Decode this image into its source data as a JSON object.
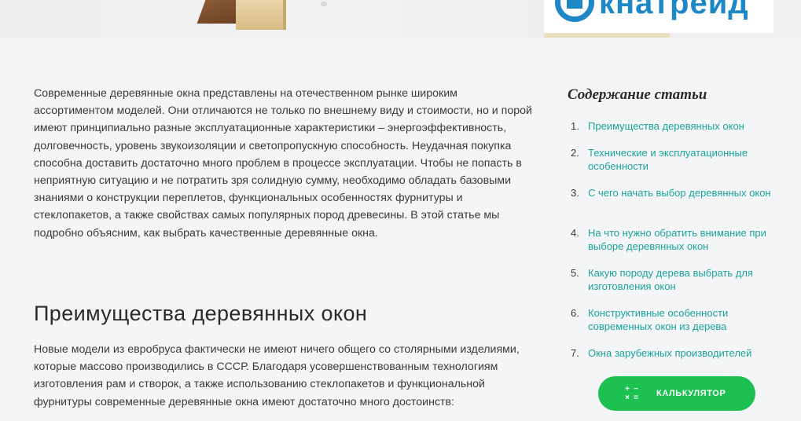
{
  "hero": {
    "logo_text": "кнатрейд",
    "logo_icon": "window-logo-icon"
  },
  "article": {
    "intro": "Современные деревянные окна представлены на отечественном рынке широким ассортиментом моделей. Они отличаются не только по внешнему виду и стоимости, но и порой имеют принципиально разные эксплуатационные характеристики – энергоэффективность, долговечность, уровень звукоизоляции и светопропускную способность. Неудачная покупка способна доставить достаточно много проблем в процессе эксплуатации. Чтобы не попасть в неприятную ситуацию и не потратить зря солидную сумму, необходимо обладать базовыми знаниями о конструкции переплетов, функциональных особенностях фурнитуры и стеклопакетов, а также свойствах самых популярных пород древесины. В этой статье мы подробно объясним, как выбрать качественные деревянные окна.",
    "section_title": "Преимущества деревянных окон",
    "section_text": "Новые модели из евробруса фактически не имеют ничего общего со столярными изделиями, которые массово производились в СССР. Благодаря усовершенствованным технологиям изготовления рам и створок, а также использованию стеклопакетов и функциональной фурнитуры современные деревянные окна имеют достаточно много достоинств:"
  },
  "toc": {
    "title": "Содержание статьи",
    "items": [
      {
        "num": "1.",
        "label": "Преимущества деревянных окон"
      },
      {
        "num": "2.",
        "label": "Технические и эксплуатационные особенности"
      },
      {
        "num": "3.",
        "label": "С чего начать выбор деревянных окон"
      },
      {
        "num": "4.",
        "label": "На что нужно обратить внимание при выборе деревянных окон"
      },
      {
        "num": "5.",
        "label": "Какую породу дерева выбрать для изготовления окон"
      },
      {
        "num": "6.",
        "label": "Конструктивные особенности современных окон из дерева"
      },
      {
        "num": "7.",
        "label": "Окна зарубежных производителей"
      }
    ]
  },
  "calculator": {
    "label": "КАЛЬКУЛЯТОР",
    "icon": "calculator-icon",
    "icon_glyphs": [
      "+",
      "−",
      "×",
      "="
    ]
  },
  "colors": {
    "link": "#1aa39b",
    "button": "#1cc151",
    "logo": "#1e88c7",
    "background": "#f4f5f6"
  }
}
